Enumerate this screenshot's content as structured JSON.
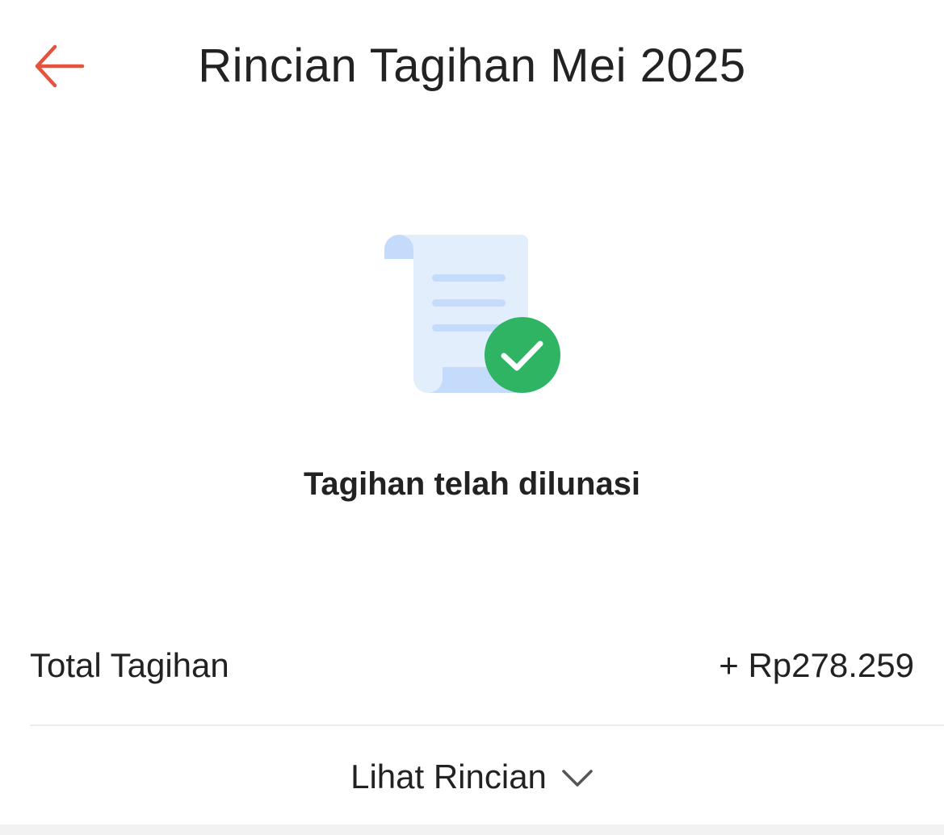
{
  "header": {
    "title": "Rincian Tagihan Mei 2025",
    "back_icon": "arrow-left-icon",
    "accent_color": "#E5533D"
  },
  "status": {
    "illustration_icon": "paid-bill-icon",
    "check_color": "#2FB463",
    "message": "Tagihan telah dilunasi"
  },
  "summary": {
    "total_label": "Total Tagihan",
    "total_value": "+ Rp278.259"
  },
  "details": {
    "label": "Lihat Rincian",
    "chevron_icon": "chevron-down-icon"
  }
}
